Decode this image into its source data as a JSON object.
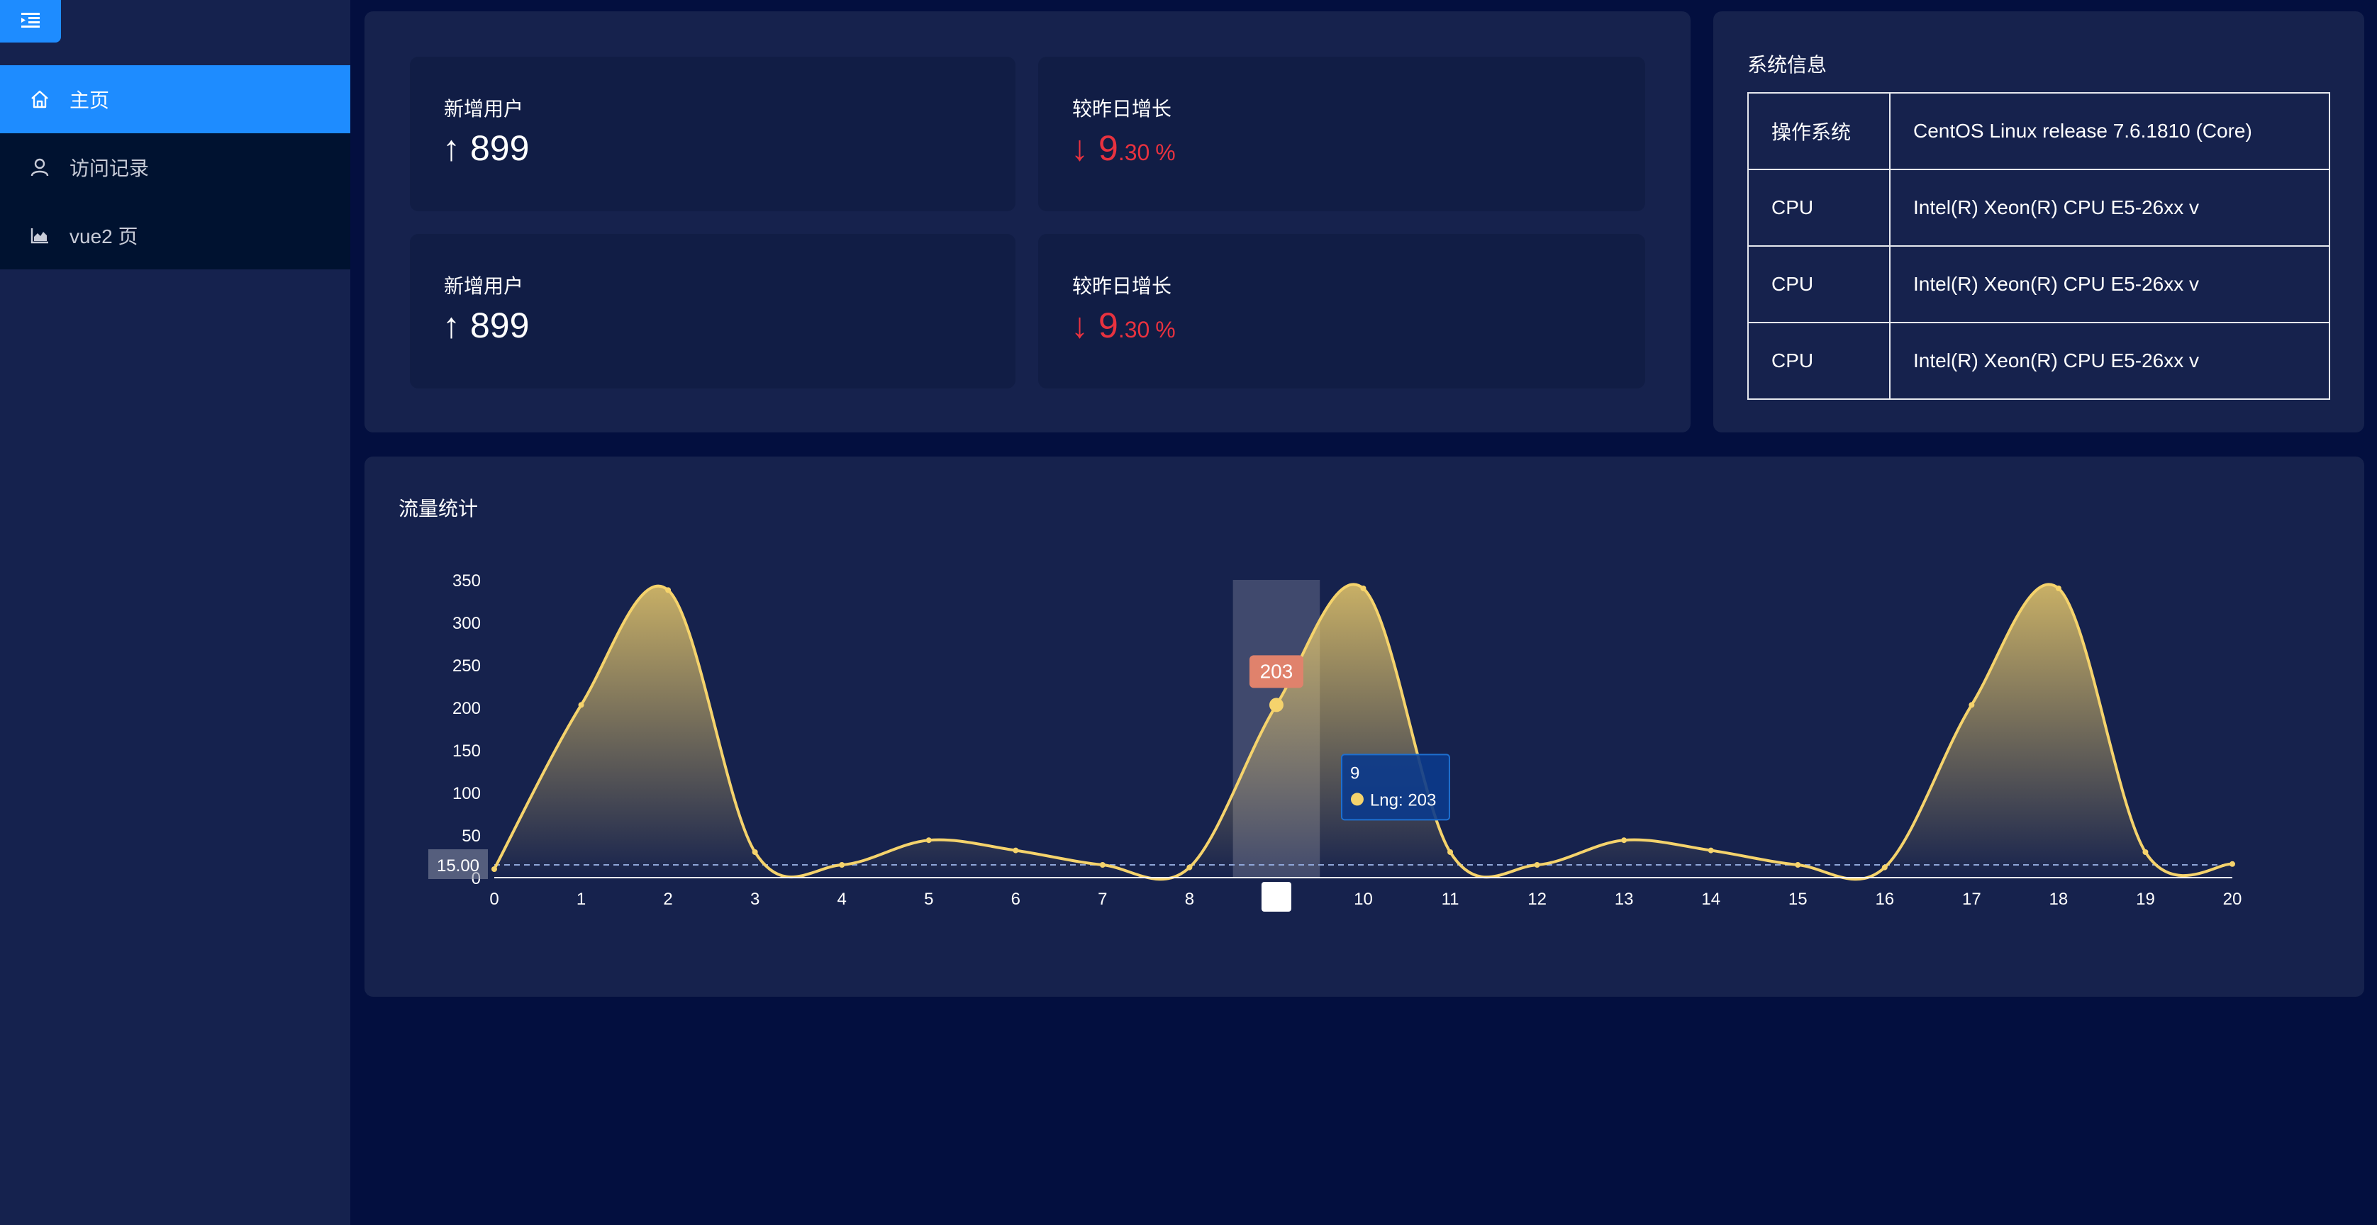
{
  "sidebar": {
    "toggle_icon": "menu-fold-icon",
    "items": [
      {
        "label": "主页",
        "icon": "home-icon",
        "active": true
      },
      {
        "label": "访问记录",
        "icon": "user-icon",
        "active": false
      },
      {
        "label": "vue2 页",
        "icon": "area-chart-icon",
        "active": false
      }
    ]
  },
  "stats": [
    {
      "label": "新增用户",
      "arrow": "↑",
      "value": "899"
    },
    {
      "label": "较昨日增长",
      "arrow": "↓",
      "int": "9",
      "frac": ".30",
      "unit": "%"
    },
    {
      "label": "新增用户",
      "arrow": "↑",
      "value": "899"
    },
    {
      "label": "较昨日增长",
      "arrow": "↓",
      "int": "9",
      "frac": ".30",
      "unit": "%"
    }
  ],
  "system_info": {
    "title": "系统信息",
    "rows": [
      {
        "key": "操作系统",
        "value": "CentOS Linux release 7.6.1810 (Core)"
      },
      {
        "key": "CPU",
        "value": "Intel(R) Xeon(R) CPU E5-26xx v"
      },
      {
        "key": "CPU",
        "value": "Intel(R) Xeon(R) CPU E5-26xx v"
      },
      {
        "key": "CPU",
        "value": "Intel(R) Xeon(R) CPU E5-26xx v"
      }
    ]
  },
  "traffic": {
    "title": "流量统计",
    "tooltip": {
      "x": "9",
      "series": "Lng",
      "value": "203"
    },
    "markpoint_label": "203",
    "markline_label": "15.00"
  },
  "colors": {
    "accent": "#1e8cff",
    "line": "#f5d36c",
    "down": "#e8323f",
    "markpoint": "#e0826c"
  },
  "chart_data": {
    "type": "area",
    "series": [
      {
        "name": "Lng",
        "values": [
          10,
          203,
          338,
          30,
          15,
          44,
          32,
          15,
          12,
          203,
          340,
          30,
          15,
          44,
          32,
          15,
          12,
          203,
          340,
          30,
          16
        ]
      }
    ],
    "x": [
      0,
      1,
      2,
      3,
      4,
      5,
      6,
      7,
      8,
      9,
      10,
      11,
      12,
      13,
      14,
      15,
      16,
      17,
      18,
      19,
      20
    ],
    "y_ticks": [
      0,
      50,
      100,
      150,
      200,
      250,
      300,
      350
    ],
    "ylim": [
      0,
      350
    ],
    "highlight_x": 9,
    "markline_y": 15,
    "grid": false
  }
}
